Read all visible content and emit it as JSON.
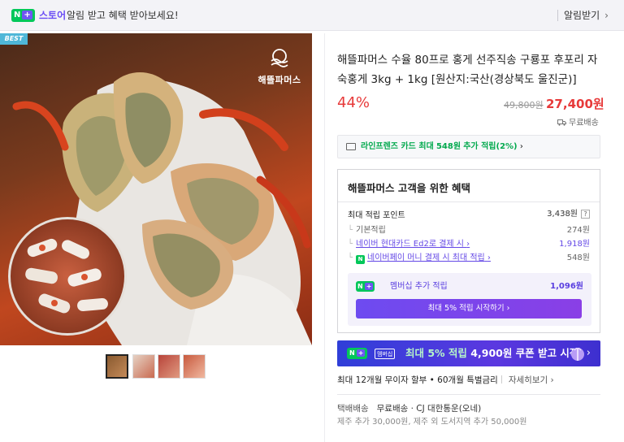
{
  "banner": {
    "nplus_n": "N",
    "nplus_plus": "+",
    "store_label": "스토어",
    "message": "알림 받고 혜택 받아보세요!",
    "notify_label": "알림받기",
    "notify_chevron": "›"
  },
  "gallery": {
    "best_tag": "BEST",
    "brand_logo_text": "해뜰파머스",
    "thumbnail_count": 4,
    "active_thumbnail": 1
  },
  "product": {
    "title": "해뜰파머스 수율 80프로 홍게 선주직송 구룡포 후포리 자숙홍게 3kg + 1kg [원산지:국산(경상북도 울진군)]",
    "discount": "44%",
    "original_price": "49,800원",
    "sale_price": "27,400원",
    "shipping": "무료배송"
  },
  "card_promo": {
    "prefix": "라인프렌즈 카드 최대",
    "amount": "548원",
    "suffix": "추가 적립(2%)",
    "chevron": "›"
  },
  "benefits": {
    "title": "해뜰파머스 고객을 위한 혜택",
    "max_points_label": "최대 적립 포인트",
    "max_points_value": "3,438원",
    "help": "?",
    "basic_label": "기본적립",
    "basic_value": "274원",
    "card_label": "네이버 현대카드 Ed2로 결제 시",
    "card_chevron": "›",
    "card_value": "1,918원",
    "npay_icon": "N",
    "npay_label": "네이버페이 머니 결제 시 최대 적립",
    "npay_chevron": "›",
    "npay_value": "548원",
    "member_n": "N",
    "member_plus": "+",
    "member_label": "멤버십 추가 적립",
    "member_value": "1,096원",
    "member_button": "최대 5% 적립 시작하기 ›"
  },
  "coupon_banner": {
    "badge_n": "N",
    "badge_plus": "+",
    "membership_tag": "멤버십",
    "text_highlight": "최대 5% 적립",
    "text_rest": "4,900원 쿠폰 받고 시작",
    "chevron": "›"
  },
  "installment": {
    "text": "최대 12개월 무이자 할부 • 60개월 특별금리",
    "more": "자세히보기 ›"
  },
  "delivery": {
    "label": "택배배송",
    "info": "무료배송 · CJ 대한통운(오네)",
    "extra": "제주 추가 30,000원, 제주 외 도서지역 추가 50,000원"
  },
  "colors": {
    "brand_green": "#03c75a",
    "accent_purple": "#6448e6",
    "sale_red": "#e73a3a"
  }
}
